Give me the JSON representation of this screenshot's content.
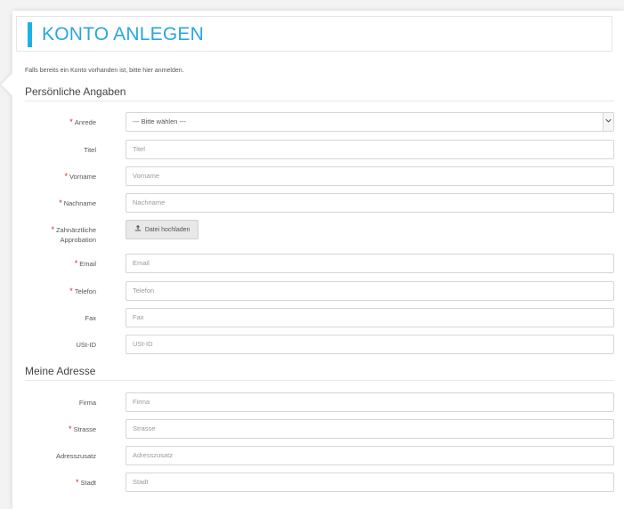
{
  "colors": {
    "accent": "#1eb1e8",
    "title": "#2aa6dd",
    "required": "#d9281c"
  },
  "page": {
    "title": "KONTO ANLEGEN",
    "intro": "Falls bereits ein Konto vorhanden ist, bitte hier anmelden."
  },
  "sections": {
    "personal": "Persönliche Angaben",
    "address": "Meine Adresse"
  },
  "fields": {
    "anrede": {
      "label": "Anrede",
      "value": " --- Bitte wählen --- ",
      "required": true
    },
    "titel": {
      "label": "Titel",
      "placeholder": "Titel"
    },
    "vorname": {
      "label": "Vorname",
      "placeholder": "Vorname",
      "required": true
    },
    "nachname": {
      "label": "Nachname",
      "placeholder": "Nachname",
      "required": true
    },
    "approbation": {
      "label_line1": "Zahnärztliche",
      "label_line2": "Approbation",
      "button": "Datei hochladen",
      "required": true
    },
    "email": {
      "label": "Email",
      "placeholder": "Email",
      "required": true
    },
    "telefon": {
      "label": "Telefon",
      "placeholder": "Telefon",
      "required": true
    },
    "fax": {
      "label": "Fax",
      "placeholder": "Fax"
    },
    "ustid": {
      "label": "USt-ID",
      "placeholder": "USt-ID"
    },
    "firma": {
      "label": "Firma",
      "placeholder": "Firma"
    },
    "strasse": {
      "label": "Strasse",
      "placeholder": "Strasse",
      "required": true
    },
    "adresszusatz": {
      "label": "Adresszusatz",
      "placeholder": "Adresszusatz"
    },
    "stadt": {
      "label": "Stadt",
      "placeholder": "Stadt",
      "required": true
    }
  },
  "icons": {
    "upload": "upload-icon",
    "select": "chevron-down-icon"
  },
  "required_mark": "*"
}
